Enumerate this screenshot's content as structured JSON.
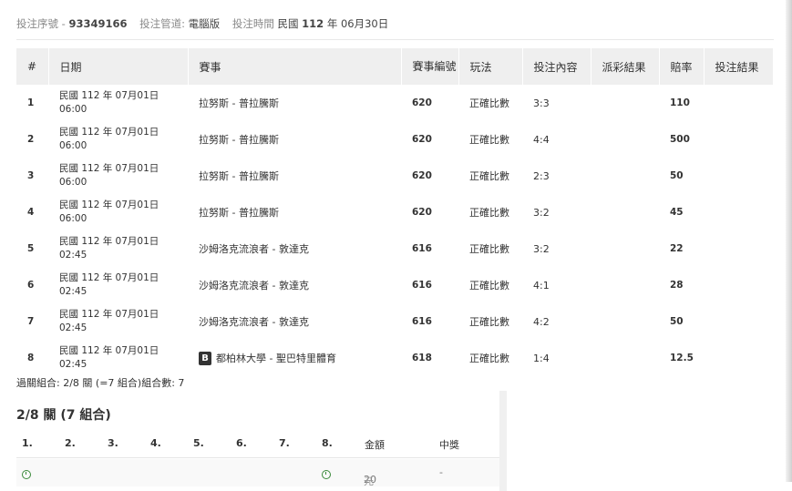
{
  "header": {
    "serial_label": "投注序號 -",
    "serial_value": "93349166",
    "channel_label": "投注管道:",
    "channel_value": "電腦版",
    "time_label": "投注時間",
    "time_prefix": "民國",
    "time_year": "112",
    "time_mid": "年",
    "time_date": "06月30日"
  },
  "table": {
    "columns": [
      "#",
      "日期",
      "賽事",
      "賽事編號",
      "玩法",
      "投注內容",
      "派彩結果",
      "賠率",
      "投注結果"
    ],
    "rows": [
      {
        "no": "1",
        "date1": "民國 112 年 07月01日",
        "date2": "06:00",
        "event": "拉努斯 - 普拉騰斯",
        "badge": "",
        "match_no": "620",
        "play": "正確比數",
        "content": "3:3",
        "payout": "",
        "odds": "110",
        "result": ""
      },
      {
        "no": "2",
        "date1": "民國 112 年 07月01日",
        "date2": "06:00",
        "event": "拉努斯 - 普拉騰斯",
        "badge": "",
        "match_no": "620",
        "play": "正確比數",
        "content": "4:4",
        "payout": "",
        "odds": "500",
        "result": ""
      },
      {
        "no": "3",
        "date1": "民國 112 年 07月01日",
        "date2": "06:00",
        "event": "拉努斯 - 普拉騰斯",
        "badge": "",
        "match_no": "620",
        "play": "正確比數",
        "content": "2:3",
        "payout": "",
        "odds": "50",
        "result": ""
      },
      {
        "no": "4",
        "date1": "民國 112 年 07月01日",
        "date2": "06:00",
        "event": "拉努斯 - 普拉騰斯",
        "badge": "",
        "match_no": "620",
        "play": "正確比數",
        "content": "3:2",
        "payout": "",
        "odds": "45",
        "result": ""
      },
      {
        "no": "5",
        "date1": "民國 112 年 07月01日",
        "date2": "02:45",
        "event": "沙姆洛克流浪者 - 敦達克",
        "badge": "",
        "match_no": "616",
        "play": "正確比數",
        "content": "3:2",
        "payout": "",
        "odds": "22",
        "result": ""
      },
      {
        "no": "6",
        "date1": "民國 112 年 07月01日",
        "date2": "02:45",
        "event": "沙姆洛克流浪者 - 敦達克",
        "badge": "",
        "match_no": "616",
        "play": "正確比數",
        "content": "4:1",
        "payout": "",
        "odds": "28",
        "result": ""
      },
      {
        "no": "7",
        "date1": "民國 112 年 07月01日",
        "date2": "02:45",
        "event": "沙姆洛克流浪者 - 敦達克",
        "badge": "",
        "match_no": "616",
        "play": "正確比數",
        "content": "4:2",
        "payout": "",
        "odds": "50",
        "result": ""
      },
      {
        "no": "8",
        "date1": "民國 112 年 07月01日",
        "date2": "02:45",
        "event": "都柏林大學 - 聖巴特里體育",
        "badge": "B",
        "match_no": "618",
        "play": "正確比數",
        "content": "1:4",
        "payout": "",
        "odds": "12.5",
        "result": ""
      }
    ]
  },
  "summary": "過關組合: 2/8 關 (=7 組合)組合數: 7",
  "combo": {
    "title": "2/8 關 (7 組合)",
    "positions": [
      "1.",
      "2.",
      "3.",
      "4.",
      "5.",
      "6.",
      "7.",
      "8."
    ],
    "amount_label": "金額",
    "prize_label": "中獎",
    "row": {
      "amount": "20",
      "unit": "元",
      "prize": "-"
    },
    "icons": [
      "clock-icon"
    ],
    "icon_color": "#3a8a3a"
  }
}
